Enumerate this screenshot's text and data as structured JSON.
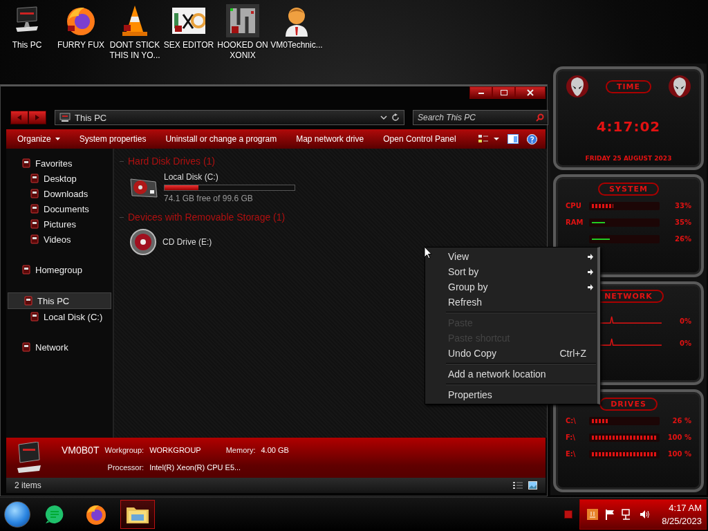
{
  "desktop_icons": [
    {
      "label": "This PC",
      "kind": "computer"
    },
    {
      "label": "FURRY FUX",
      "kind": "browser"
    },
    {
      "label": "DONT STICK THIS IN YO...",
      "kind": "cone"
    },
    {
      "label": "SEX EDITOR",
      "kind": "editor"
    },
    {
      "label": "HOOKED ON XONIX",
      "kind": "maze"
    },
    {
      "label": "VM0Technic...",
      "kind": "person"
    }
  ],
  "explorer": {
    "address": "This PC",
    "search_placeholder": "Search This PC",
    "toolbar": [
      {
        "label": "Organize",
        "dropdown": true
      },
      {
        "label": "System properties",
        "dropdown": false
      },
      {
        "label": "Uninstall or change a program",
        "dropdown": false
      },
      {
        "label": "Map network drive",
        "dropdown": false
      },
      {
        "label": "Open Control Panel",
        "dropdown": false
      }
    ],
    "navigation": [
      {
        "label": "Favorites",
        "selected": false,
        "children": [
          {
            "label": "Desktop",
            "selected": false
          },
          {
            "label": "Downloads",
            "selected": false
          },
          {
            "label": "Documents",
            "selected": false
          },
          {
            "label": "Pictures",
            "selected": false
          },
          {
            "label": "Videos",
            "selected": false
          }
        ]
      },
      {
        "label": "Homegroup",
        "selected": false
      },
      {
        "label": "This PC",
        "selected": true,
        "children": [
          {
            "label": "Local Disk (C:)",
            "selected": false
          }
        ]
      },
      {
        "label": "Network",
        "selected": false
      }
    ],
    "groups": [
      {
        "title": "Hard Disk Drives (1)",
        "items": [
          {
            "kind": "disk",
            "name": "Local Disk (C:)",
            "level": 0.26,
            "free": "74.1 GB free of 99.6 GB"
          }
        ]
      },
      {
        "title": "Devices with Removable Storage (1)",
        "items": [
          {
            "kind": "cd",
            "name": "CD Drive (E:)"
          }
        ]
      }
    ],
    "details": {
      "name": "VM0B0T",
      "fields": [
        {
          "label": "Workgroup:",
          "value": "WORKGROUP"
        },
        {
          "label": "Memory:",
          "value": "4.00 GB"
        },
        {
          "label": "Processor:",
          "value": "Intel(R) Xeon(R) CPU E5..."
        }
      ]
    },
    "status": "2 items"
  },
  "context_menu": [
    {
      "kind": "item",
      "label": "View",
      "submenu": true,
      "disabled": false
    },
    {
      "kind": "item",
      "label": "Sort by",
      "submenu": true,
      "disabled": false
    },
    {
      "kind": "item",
      "label": "Group by",
      "submenu": true,
      "disabled": false
    },
    {
      "kind": "item",
      "label": "Refresh",
      "submenu": false,
      "disabled": false
    },
    {
      "kind": "separator"
    },
    {
      "kind": "item",
      "label": "Paste",
      "submenu": false,
      "disabled": true
    },
    {
      "kind": "item",
      "label": "Paste shortcut",
      "submenu": false,
      "disabled": true
    },
    {
      "kind": "item",
      "label": "Undo Copy",
      "shortcut": "Ctrl+Z",
      "submenu": false,
      "disabled": false
    },
    {
      "kind": "separator"
    },
    {
      "kind": "item",
      "label": "Add a network location",
      "submenu": false,
      "disabled": false
    },
    {
      "kind": "separator"
    },
    {
      "kind": "item",
      "label": "Properties",
      "submenu": false,
      "disabled": false
    }
  ],
  "gadgets": {
    "time": {
      "title": "TIME",
      "clock": "4:17:02",
      "date": "FRIDAY 25 AUGUST 2023"
    },
    "system": {
      "title": "SYSTEM",
      "rows": [
        {
          "label": "CPU",
          "kind": "arrows",
          "level": 0.33,
          "reading": "33%"
        },
        {
          "label": "RAM",
          "kind": "line",
          "level": 0.2,
          "reading": "35%"
        },
        {
          "kind": "line",
          "level": 0.28,
          "reading": "26%"
        }
      ]
    },
    "network": {
      "title": "NETWORK",
      "readings": [
        "0%",
        "0%"
      ]
    },
    "drives": {
      "title": "DRIVES",
      "rows": [
        {
          "label": "C:\\",
          "kind": "arrows",
          "level": 0.26,
          "reading": "26 %"
        },
        {
          "label": "F:\\",
          "kind": "arrows",
          "level": 1,
          "reading": "100 %"
        },
        {
          "label": "E:\\",
          "kind": "arrows",
          "level": 1,
          "reading": "100 %"
        }
      ]
    }
  },
  "taskbar": {
    "apps": [
      {
        "kind": "chat",
        "active": false
      },
      {
        "kind": "browser",
        "active": false
      },
      {
        "kind": "folder",
        "active": true
      }
    ],
    "clock": {
      "time": "4:17 AM",
      "date": "8/25/2023"
    }
  }
}
